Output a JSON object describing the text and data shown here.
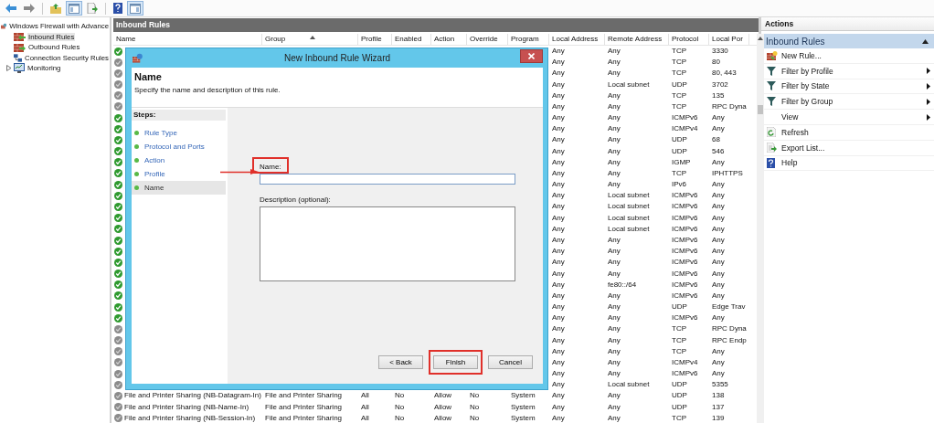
{
  "tree": {
    "items": [
      {
        "label": "Windows Firewall with Advance",
        "kind": "firewall",
        "selected": false,
        "children": [
          {
            "label": "Inbound Rules",
            "kind": "inbound",
            "selected": true
          },
          {
            "label": "Outbound Rules",
            "kind": "outbound",
            "selected": false
          },
          {
            "label": "Connection Security Rules",
            "kind": "security",
            "selected": false
          },
          {
            "label": "Monitoring",
            "kind": "monitor",
            "selected": false,
            "expanded": false
          }
        ]
      }
    ]
  },
  "table": {
    "title": "Inbound Rules",
    "columns": [
      {
        "label": "Name",
        "sorted": false
      },
      {
        "label": "Group",
        "sorted": true
      },
      {
        "label": "Profile",
        "sorted": false
      },
      {
        "label": "Enabled",
        "sorted": false
      },
      {
        "label": "Action",
        "sorted": false
      },
      {
        "label": "Override",
        "sorted": false
      },
      {
        "label": "Program",
        "sorted": false
      },
      {
        "label": "Local Address",
        "sorted": false
      },
      {
        "label": "Remote Address",
        "sorted": false
      },
      {
        "label": "Protocol",
        "sorted": false
      },
      {
        "label": "Local Por",
        "sorted": false
      }
    ],
    "rows": [
      {
        "enabled": true,
        "local_address": "Any",
        "remote_address": "Any",
        "protocol": "TCP",
        "local_port": "3330"
      },
      {
        "enabled": false,
        "local_address": "Any",
        "remote_address": "Any",
        "protocol": "TCP",
        "local_port": "80"
      },
      {
        "enabled": false,
        "local_address": "Any",
        "remote_address": "Any",
        "protocol": "TCP",
        "local_port": "80, 443"
      },
      {
        "enabled": false,
        "local_address": "Any",
        "remote_address": "Local subnet",
        "protocol": "UDP",
        "local_port": "3702"
      },
      {
        "enabled": false,
        "local_address": "Any",
        "remote_address": "Any",
        "protocol": "TCP",
        "local_port": "135"
      },
      {
        "enabled": false,
        "local_address": "Any",
        "remote_address": "Any",
        "protocol": "TCP",
        "local_port": "RPC Dyna"
      },
      {
        "enabled": true,
        "local_address": "Any",
        "remote_address": "Any",
        "protocol": "ICMPv6",
        "local_port": "Any"
      },
      {
        "enabled": true,
        "local_address": "Any",
        "remote_address": "Any",
        "protocol": "ICMPv4",
        "local_port": "Any"
      },
      {
        "enabled": true,
        "local_address": "Any",
        "remote_address": "Any",
        "protocol": "UDP",
        "local_port": "68"
      },
      {
        "enabled": true,
        "local_address": "Any",
        "remote_address": "Any",
        "protocol": "UDP",
        "local_port": "546"
      },
      {
        "enabled": true,
        "local_address": "Any",
        "remote_address": "Any",
        "protocol": "IGMP",
        "local_port": "Any"
      },
      {
        "enabled": true,
        "local_address": "Any",
        "remote_address": "Any",
        "protocol": "TCP",
        "local_port": "IPHTTPS"
      },
      {
        "enabled": true,
        "local_address": "Any",
        "remote_address": "Any",
        "protocol": "IPv6",
        "local_port": "Any"
      },
      {
        "enabled": true,
        "local_address": "Any",
        "remote_address": "Local subnet",
        "protocol": "ICMPv6",
        "local_port": "Any"
      },
      {
        "enabled": true,
        "local_address": "Any",
        "remote_address": "Local subnet",
        "protocol": "ICMPv6",
        "local_port": "Any"
      },
      {
        "enabled": true,
        "local_address": "Any",
        "remote_address": "Local subnet",
        "protocol": "ICMPv6",
        "local_port": "Any"
      },
      {
        "enabled": true,
        "local_address": "Any",
        "remote_address": "Local subnet",
        "protocol": "ICMPv6",
        "local_port": "Any"
      },
      {
        "enabled": true,
        "local_address": "Any",
        "remote_address": "Any",
        "protocol": "ICMPv6",
        "local_port": "Any"
      },
      {
        "enabled": true,
        "local_address": "Any",
        "remote_address": "Any",
        "protocol": "ICMPv6",
        "local_port": "Any"
      },
      {
        "enabled": true,
        "local_address": "Any",
        "remote_address": "Any",
        "protocol": "ICMPv6",
        "local_port": "Any"
      },
      {
        "enabled": true,
        "local_address": "Any",
        "remote_address": "Any",
        "protocol": "ICMPv6",
        "local_port": "Any"
      },
      {
        "enabled": true,
        "local_address": "Any",
        "remote_address": "fe80::/64",
        "protocol": "ICMPv6",
        "local_port": "Any"
      },
      {
        "enabled": true,
        "local_address": "Any",
        "remote_address": "Any",
        "protocol": "ICMPv6",
        "local_port": "Any"
      },
      {
        "enabled": true,
        "local_address": "Any",
        "remote_address": "Any",
        "protocol": "UDP",
        "local_port": "Edge Trav"
      },
      {
        "enabled": true,
        "local_address": "Any",
        "remote_address": "Any",
        "protocol": "ICMPv6",
        "local_port": "Any"
      },
      {
        "enabled": false,
        "local_address": "Any",
        "remote_address": "Any",
        "protocol": "TCP",
        "local_port": "RPC Dyna"
      },
      {
        "enabled": false,
        "local_address": "Any",
        "remote_address": "Any",
        "protocol": "TCP",
        "local_port": "RPC Endp"
      },
      {
        "enabled": false,
        "local_address": "Any",
        "remote_address": "Any",
        "protocol": "TCP",
        "local_port": "Any"
      },
      {
        "enabled": false,
        "local_address": "Any",
        "remote_address": "Any",
        "protocol": "ICMPv4",
        "local_port": "Any"
      },
      {
        "enabled": false,
        "local_address": "Any",
        "remote_address": "Any",
        "protocol": "ICMPv6",
        "local_port": "Any"
      },
      {
        "enabled": false,
        "local_address": "Any",
        "remote_address": "Local subnet",
        "protocol": "UDP",
        "local_port": "5355"
      },
      {
        "enabled": false,
        "name": "File and Printer Sharing (NB-Datagram-In)",
        "group": "File and Printer Sharing",
        "profile": "All",
        "enabled_label": "No",
        "action": "Allow",
        "override": "No",
        "program": "System",
        "local_address": "Any",
        "remote_address": "Any",
        "protocol": "UDP",
        "local_port": "138"
      },
      {
        "enabled": false,
        "name": "File and Printer Sharing (NB-Name-In)",
        "group": "File and Printer Sharing",
        "profile": "All",
        "enabled_label": "No",
        "action": "Allow",
        "override": "No",
        "program": "System",
        "local_address": "Any",
        "remote_address": "Any",
        "protocol": "UDP",
        "local_port": "137"
      },
      {
        "enabled": false,
        "name": "File and Printer Sharing (NB-Session-In)",
        "group": "File and Printer Sharing",
        "profile": "All",
        "enabled_label": "No",
        "action": "Allow",
        "override": "No",
        "program": "System",
        "local_address": "Any",
        "remote_address": "Any",
        "protocol": "TCP",
        "local_port": "139"
      }
    ]
  },
  "actions": {
    "title": "Actions",
    "section": {
      "title": "Inbound Rules",
      "expanded": true
    },
    "items": [
      {
        "label": "New Rule...",
        "kind": "new-rule",
        "submenu": false
      },
      {
        "label": "Filter by Profile",
        "kind": "filter",
        "submenu": true
      },
      {
        "label": "Filter by State",
        "kind": "filter",
        "submenu": true
      },
      {
        "label": "Filter by Group",
        "kind": "filter",
        "submenu": true
      },
      {
        "label": "View",
        "kind": "plain",
        "submenu": true
      },
      {
        "label": "Refresh",
        "kind": "refresh",
        "submenu": false
      },
      {
        "label": "Export List...",
        "kind": "export",
        "submenu": false
      },
      {
        "label": "Help",
        "kind": "help",
        "submenu": false
      }
    ]
  },
  "wizard": {
    "title": "New Inbound Rule Wizard",
    "heading": "Name",
    "description": "Specify the name and description of this rule.",
    "steps_title": "Steps:",
    "steps": [
      {
        "label": "Rule Type",
        "selected": false
      },
      {
        "label": "Protocol and Ports",
        "selected": false
      },
      {
        "label": "Action",
        "selected": false
      },
      {
        "label": "Profile",
        "selected": false
      },
      {
        "label": "Name",
        "selected": true
      }
    ],
    "name_label": "Name:",
    "description_label": "Description (optional):",
    "buttons": [
      {
        "label": "< Back"
      },
      {
        "label": "Finish"
      },
      {
        "label": "Cancel"
      }
    ]
  }
}
